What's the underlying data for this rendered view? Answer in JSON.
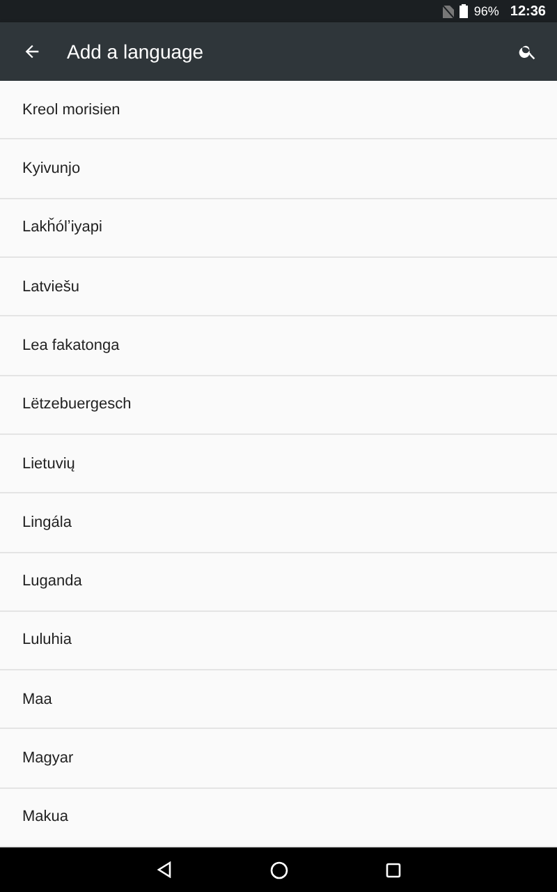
{
  "status_bar": {
    "battery": "96%",
    "time": "12:36"
  },
  "toolbar": {
    "title": "Add a language"
  },
  "languages": [
    {
      "name": "Kreol morisien"
    },
    {
      "name": "Kyivunjo"
    },
    {
      "name": "Lakȟólʼiyapi"
    },
    {
      "name": "Latviešu"
    },
    {
      "name": "Lea fakatonga"
    },
    {
      "name": "Lëtzebuergesch"
    },
    {
      "name": "Lietuvių"
    },
    {
      "name": "Lingála"
    },
    {
      "name": "Luganda"
    },
    {
      "name": "Luluhia"
    },
    {
      "name": "Maa"
    },
    {
      "name": "Magyar"
    },
    {
      "name": "Makua"
    }
  ]
}
